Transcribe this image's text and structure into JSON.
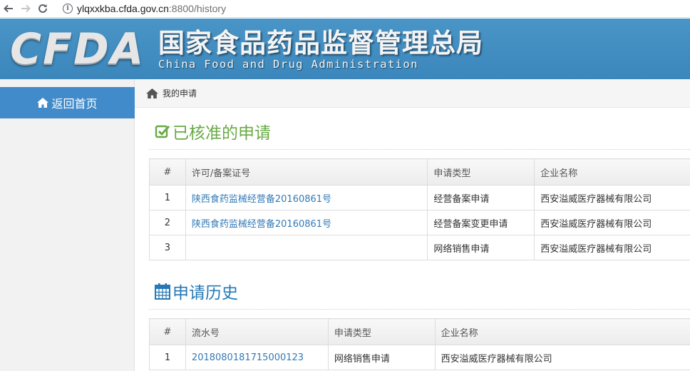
{
  "browser": {
    "url_host": "ylqxxkba.cfda.gov.cn",
    "url_rest": ":8800/history"
  },
  "header": {
    "logo": "CFDA",
    "title_cn": "国家食品药品监督管理总局",
    "title_en": "China Food and Drug Administration"
  },
  "sidebar": {
    "home_label": "返回首页"
  },
  "breadcrumb": {
    "label": "我的申请"
  },
  "approved": {
    "title": "已核准的申请",
    "headers": [
      "#",
      "许可/备案证号",
      "申请类型",
      "企业名称"
    ],
    "rows": [
      {
        "num": "1",
        "cert": "陕西食药监械经营备20160861号",
        "type": "经营备案申请",
        "company": "西安溢威医疗器械有限公司"
      },
      {
        "num": "2",
        "cert": "陕西食药监械经营备20160861号",
        "type": "经营备案变更申请",
        "company": "西安溢威医疗器械有限公司"
      },
      {
        "num": "3",
        "cert": "",
        "type": "网络销售申请",
        "company": "西安溢威医疗器械有限公司"
      }
    ]
  },
  "history": {
    "title": "申请历史",
    "headers": [
      "#",
      "流水号",
      "申请类型",
      "企业名称"
    ],
    "rows": [
      {
        "num": "1",
        "serial": "2018080181715000123",
        "type": "网络销售申请",
        "company": "西安溢威医疗器械有限公司"
      }
    ]
  },
  "colors": {
    "header_blue": "#3b86bb",
    "sidebar_active": "#428bca",
    "approved_green": "#69aa46",
    "history_blue": "#2679b5",
    "link": "#337ab7"
  }
}
